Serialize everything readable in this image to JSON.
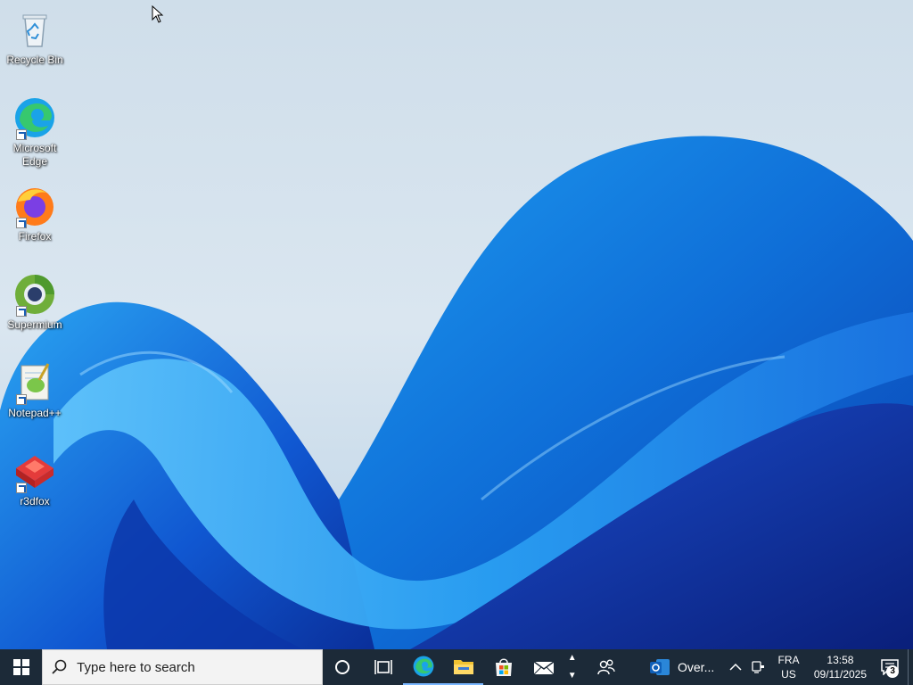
{
  "desktop": {
    "icons": [
      {
        "label": "Recycle Bin",
        "icon": "recycle-bin-icon"
      },
      {
        "label": "Microsoft Edge",
        "icon": "edge-icon"
      },
      {
        "label": "Firefox",
        "icon": "firefox-icon"
      },
      {
        "label": "Supermium",
        "icon": "supermium-icon"
      },
      {
        "label": "Notepad++",
        "icon": "notepadpp-icon"
      },
      {
        "label": "r3dfox",
        "icon": "r3dfox-icon"
      }
    ]
  },
  "taskbar": {
    "search_placeholder": "Type here to search",
    "pinned": [
      {
        "name": "cortana-icon"
      },
      {
        "name": "task-view-icon"
      },
      {
        "name": "edge-icon"
      },
      {
        "name": "file-explorer-icon"
      },
      {
        "name": "microsoft-store-icon"
      },
      {
        "name": "mail-icon"
      }
    ],
    "news_label": "Over...",
    "tray": {
      "language_top": "FRA",
      "language_bottom": "US",
      "time": "13:58",
      "date": "09/11/2025",
      "notification_count": "3"
    }
  },
  "colors": {
    "taskbar_bg": "#1c2a38",
    "accent": "#0078d4"
  }
}
